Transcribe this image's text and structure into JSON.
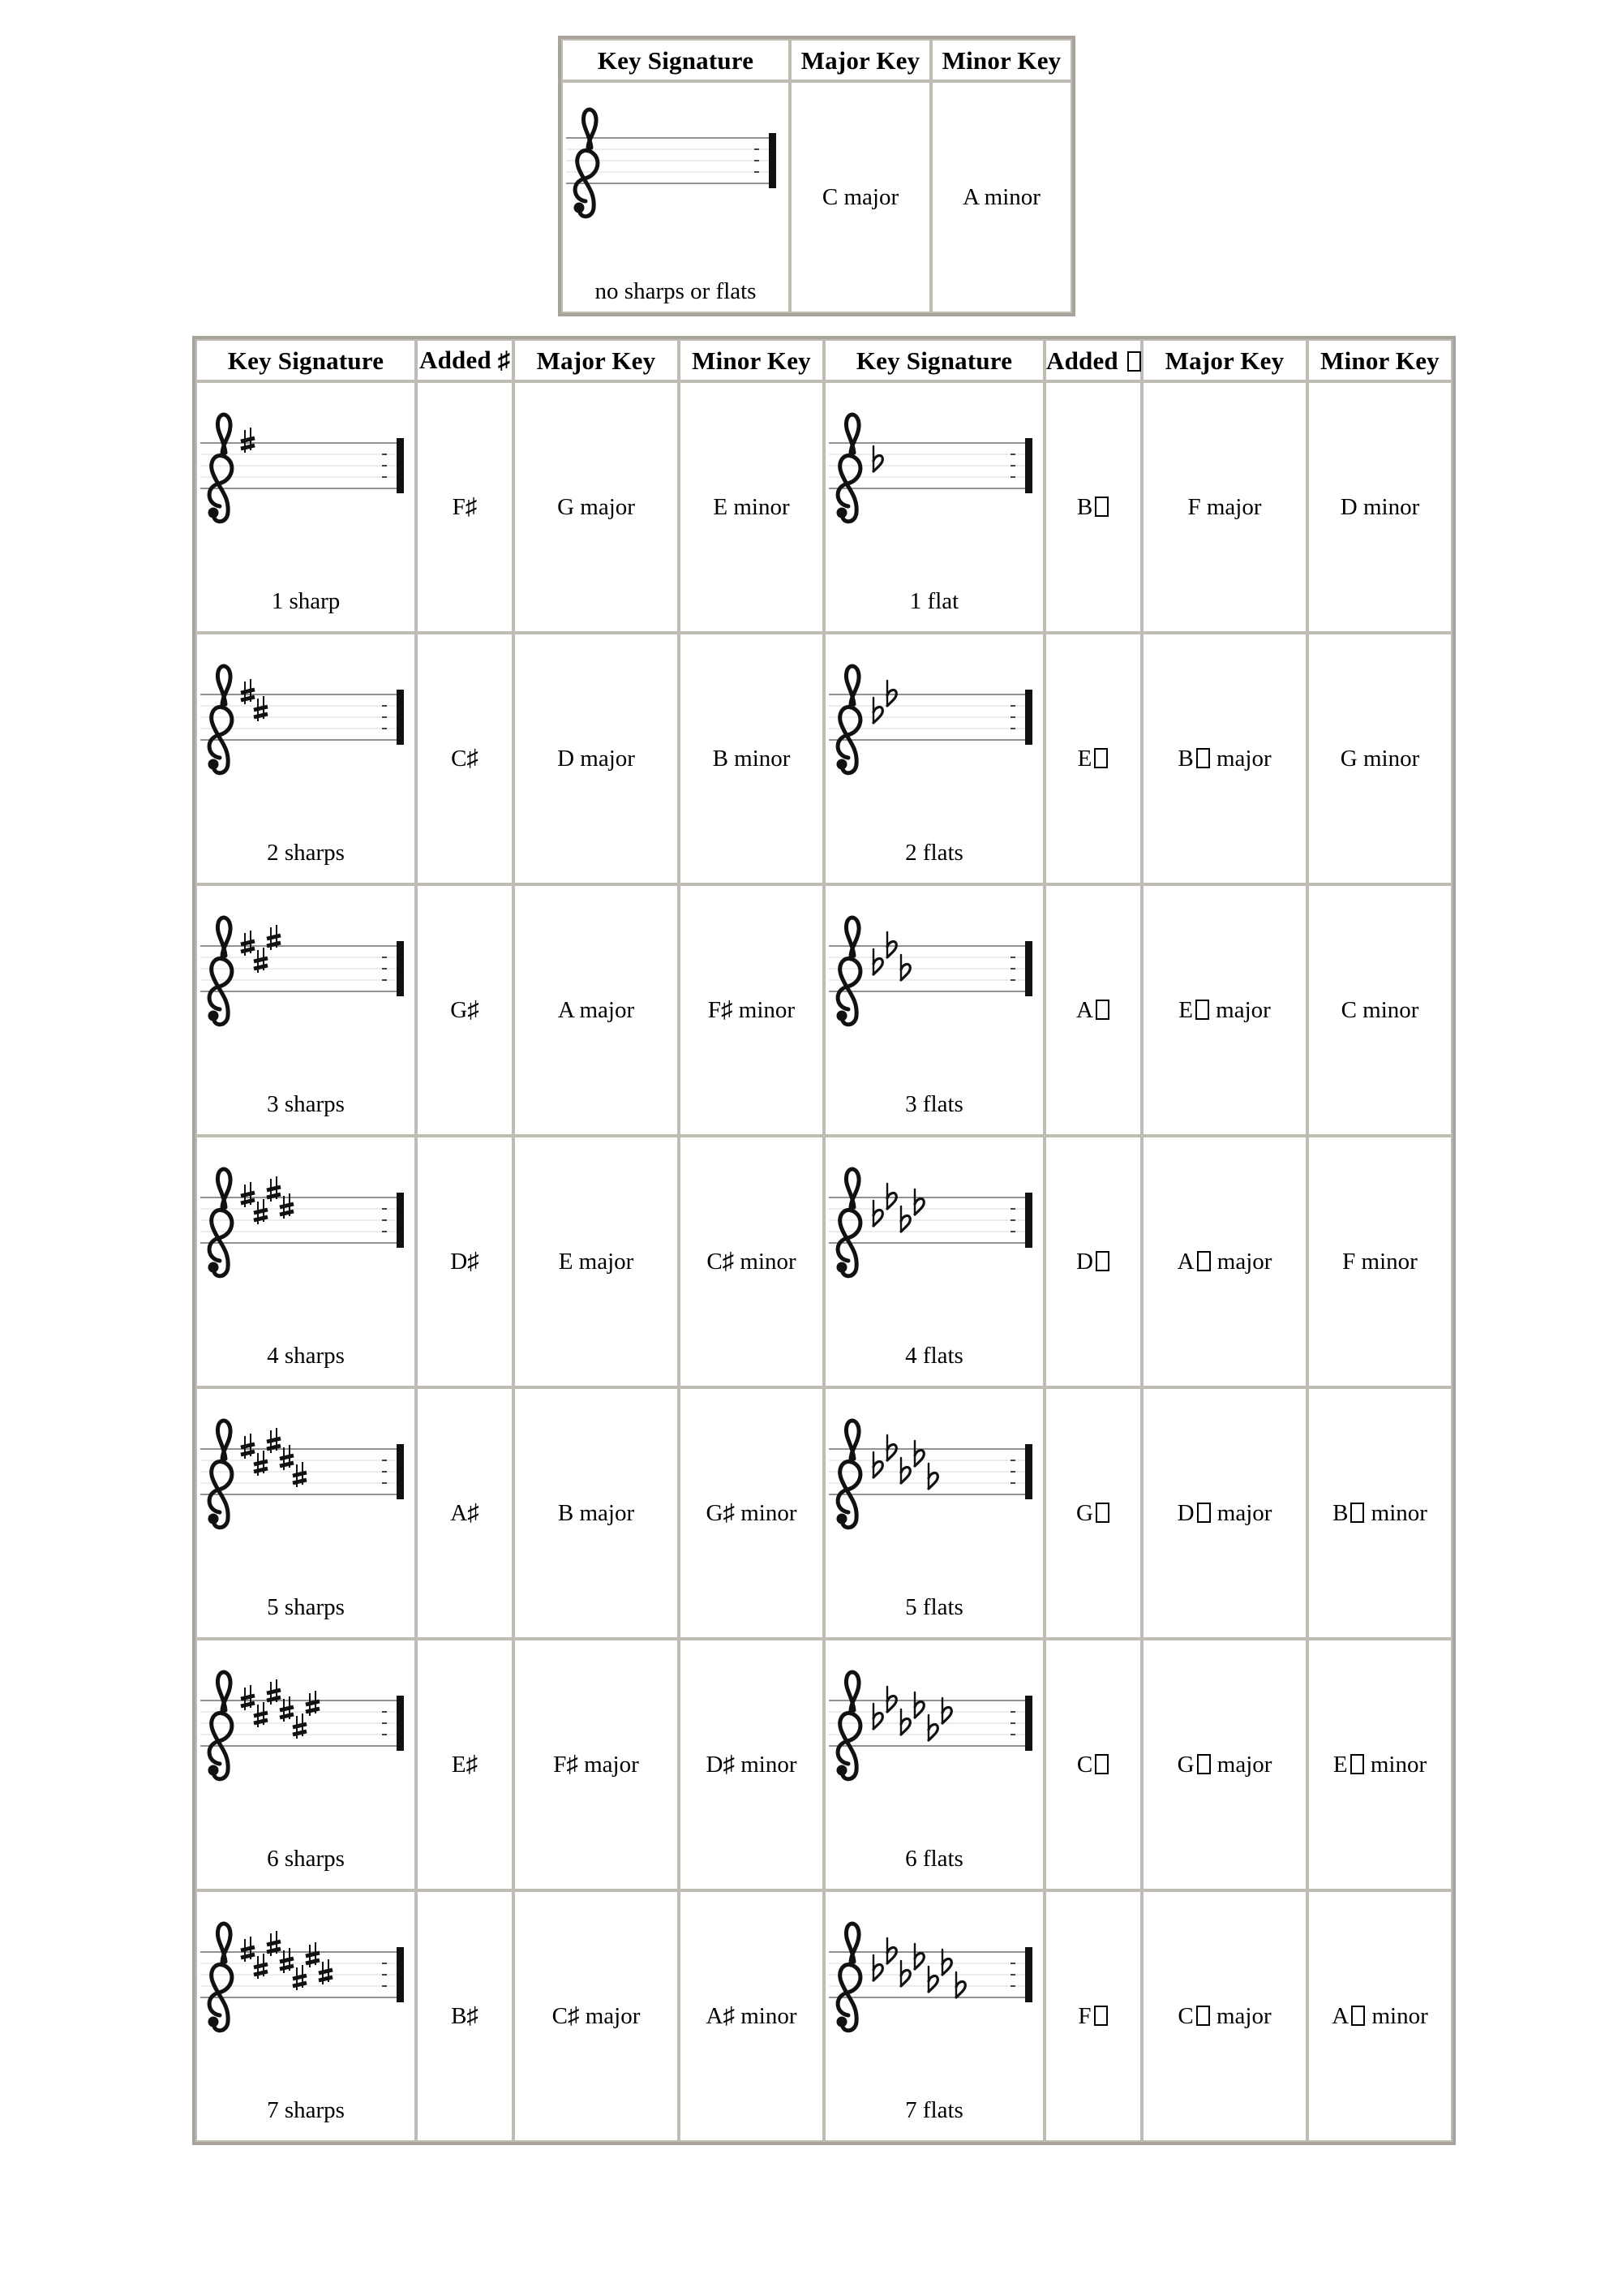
{
  "top_table": {
    "headers": [
      "Key Signature",
      "Major Key",
      "Minor Key"
    ],
    "row": {
      "caption": "no sharps or flats",
      "major": "C major",
      "minor": "A minor",
      "accidental_count": 0,
      "accidental_type": "none"
    }
  },
  "main_table": {
    "headers": {
      "sig_sharp": "Key Signature",
      "added_sharp": "Added ♯",
      "major_sharp": "Major Key",
      "minor_sharp": "Minor Key",
      "sig_flat": "Key Signature",
      "added_flat": "Added □",
      "major_flat": "Major Key",
      "minor_flat": "Minor Key"
    },
    "rows": [
      {
        "sharp": {
          "caption": "1 sharp",
          "count": 1,
          "added": "F♯",
          "added_letter": "F",
          "major": "G major",
          "minor": "E minor"
        },
        "flat": {
          "caption": "1 flat",
          "count": 1,
          "added_letter": "B",
          "added": "B□",
          "major": "F major",
          "major_letter": "F",
          "major_flat": false,
          "minor": "D minor",
          "minor_letter": "D",
          "minor_flat": false
        }
      },
      {
        "sharp": {
          "caption": "2 sharps",
          "count": 2,
          "added": "C♯",
          "added_letter": "C",
          "major": "D major",
          "minor": "B minor"
        },
        "flat": {
          "caption": "2 flats",
          "count": 2,
          "added_letter": "E",
          "added": "E□",
          "major": "B□ major",
          "major_letter": "B",
          "major_flat": true,
          "minor": "G minor",
          "minor_letter": "G",
          "minor_flat": false
        }
      },
      {
        "sharp": {
          "caption": "3 sharps",
          "count": 3,
          "added": "G♯",
          "added_letter": "G",
          "major": "A major",
          "minor": "F♯ minor"
        },
        "flat": {
          "caption": "3 flats",
          "count": 3,
          "added_letter": "A",
          "added": "A□",
          "major": "E□ major",
          "major_letter": "E",
          "major_flat": true,
          "minor": "C minor",
          "minor_letter": "C",
          "minor_flat": false
        }
      },
      {
        "sharp": {
          "caption": "4 sharps",
          "count": 4,
          "added": "D♯",
          "added_letter": "D",
          "major": "E major",
          "minor": "C♯ minor"
        },
        "flat": {
          "caption": "4 flats",
          "count": 4,
          "added_letter": "D",
          "added": "D□",
          "major": "A□ major",
          "major_letter": "A",
          "major_flat": true,
          "minor": "F minor",
          "minor_letter": "F",
          "minor_flat": false
        }
      },
      {
        "sharp": {
          "caption": "5 sharps",
          "count": 5,
          "added": "A♯",
          "added_letter": "A",
          "major": "B major",
          "minor": "G♯ minor"
        },
        "flat": {
          "caption": "5 flats",
          "count": 5,
          "added_letter": "G",
          "added": "G□",
          "major": "D□ major",
          "major_letter": "D",
          "major_flat": true,
          "minor": "B□ minor",
          "minor_letter": "B",
          "minor_flat": true
        }
      },
      {
        "sharp": {
          "caption": "6 sharps",
          "count": 6,
          "added": "E♯",
          "added_letter": "E",
          "major": "F♯ major",
          "minor": "D♯ minor"
        },
        "flat": {
          "caption": "6 flats",
          "count": 6,
          "added_letter": "C",
          "added": "C□",
          "major": "G□ major",
          "major_letter": "G",
          "major_flat": true,
          "minor": "E□ minor",
          "minor_letter": "E",
          "minor_flat": true
        }
      },
      {
        "sharp": {
          "caption": "7 sharps",
          "count": 7,
          "added": "B♯",
          "added_letter": "B",
          "major": "C♯ major",
          "minor": "A♯ minor"
        },
        "flat": {
          "caption": "7 flats",
          "count": 7,
          "added_letter": "F",
          "added": "F□",
          "major": "C□ major",
          "major_letter": "C",
          "major_flat": true,
          "minor": "A□ minor",
          "minor_letter": "A",
          "minor_flat": true
        }
      }
    ]
  },
  "chart_data": {
    "type": "table",
    "title": "Key Signature / Major Key / Minor Key reference chart",
    "columns": [
      "Key Signature",
      "Added accidental",
      "Major Key",
      "Minor Key"
    ],
    "sharps": [
      {
        "count": 0,
        "label": "no sharps or flats",
        "added": "",
        "major": "C major",
        "minor": "A minor"
      },
      {
        "count": 1,
        "label": "1 sharp",
        "added": "F♯",
        "major": "G major",
        "minor": "E minor"
      },
      {
        "count": 2,
        "label": "2 sharps",
        "added": "C♯",
        "major": "D major",
        "minor": "B minor"
      },
      {
        "count": 3,
        "label": "3 sharps",
        "added": "G♯",
        "major": "A major",
        "minor": "F♯ minor"
      },
      {
        "count": 4,
        "label": "4 sharps",
        "added": "D♯",
        "major": "E major",
        "minor": "C♯ minor"
      },
      {
        "count": 5,
        "label": "5 sharps",
        "added": "A♯",
        "major": "B major",
        "minor": "G♯ minor"
      },
      {
        "count": 6,
        "label": "6 sharps",
        "added": "E♯",
        "major": "F♯ major",
        "minor": "D♯ minor"
      },
      {
        "count": 7,
        "label": "7 sharps",
        "added": "B♯",
        "major": "C♯ major",
        "minor": "A♯ minor"
      }
    ],
    "flats": [
      {
        "count": 1,
        "label": "1 flat",
        "added": "B♭",
        "major": "F major",
        "minor": "D minor"
      },
      {
        "count": 2,
        "label": "2 flats",
        "added": "E♭",
        "major": "B♭ major",
        "minor": "G minor"
      },
      {
        "count": 3,
        "label": "3 flats",
        "added": "A♭",
        "major": "E♭ major",
        "minor": "C minor"
      },
      {
        "count": 4,
        "label": "4 flats",
        "added": "D♭",
        "major": "A♭ major",
        "minor": "F minor"
      },
      {
        "count": 5,
        "label": "5 flats",
        "added": "G♭",
        "major": "D♭ major",
        "minor": "B♭ minor"
      },
      {
        "count": 6,
        "label": "6 flats",
        "added": "C♭",
        "major": "G♭ major",
        "minor": "E♭ minor"
      },
      {
        "count": 7,
        "label": "7 flats",
        "added": "F♭",
        "major": "C♭ major",
        "minor": "A♭ minor"
      }
    ]
  }
}
